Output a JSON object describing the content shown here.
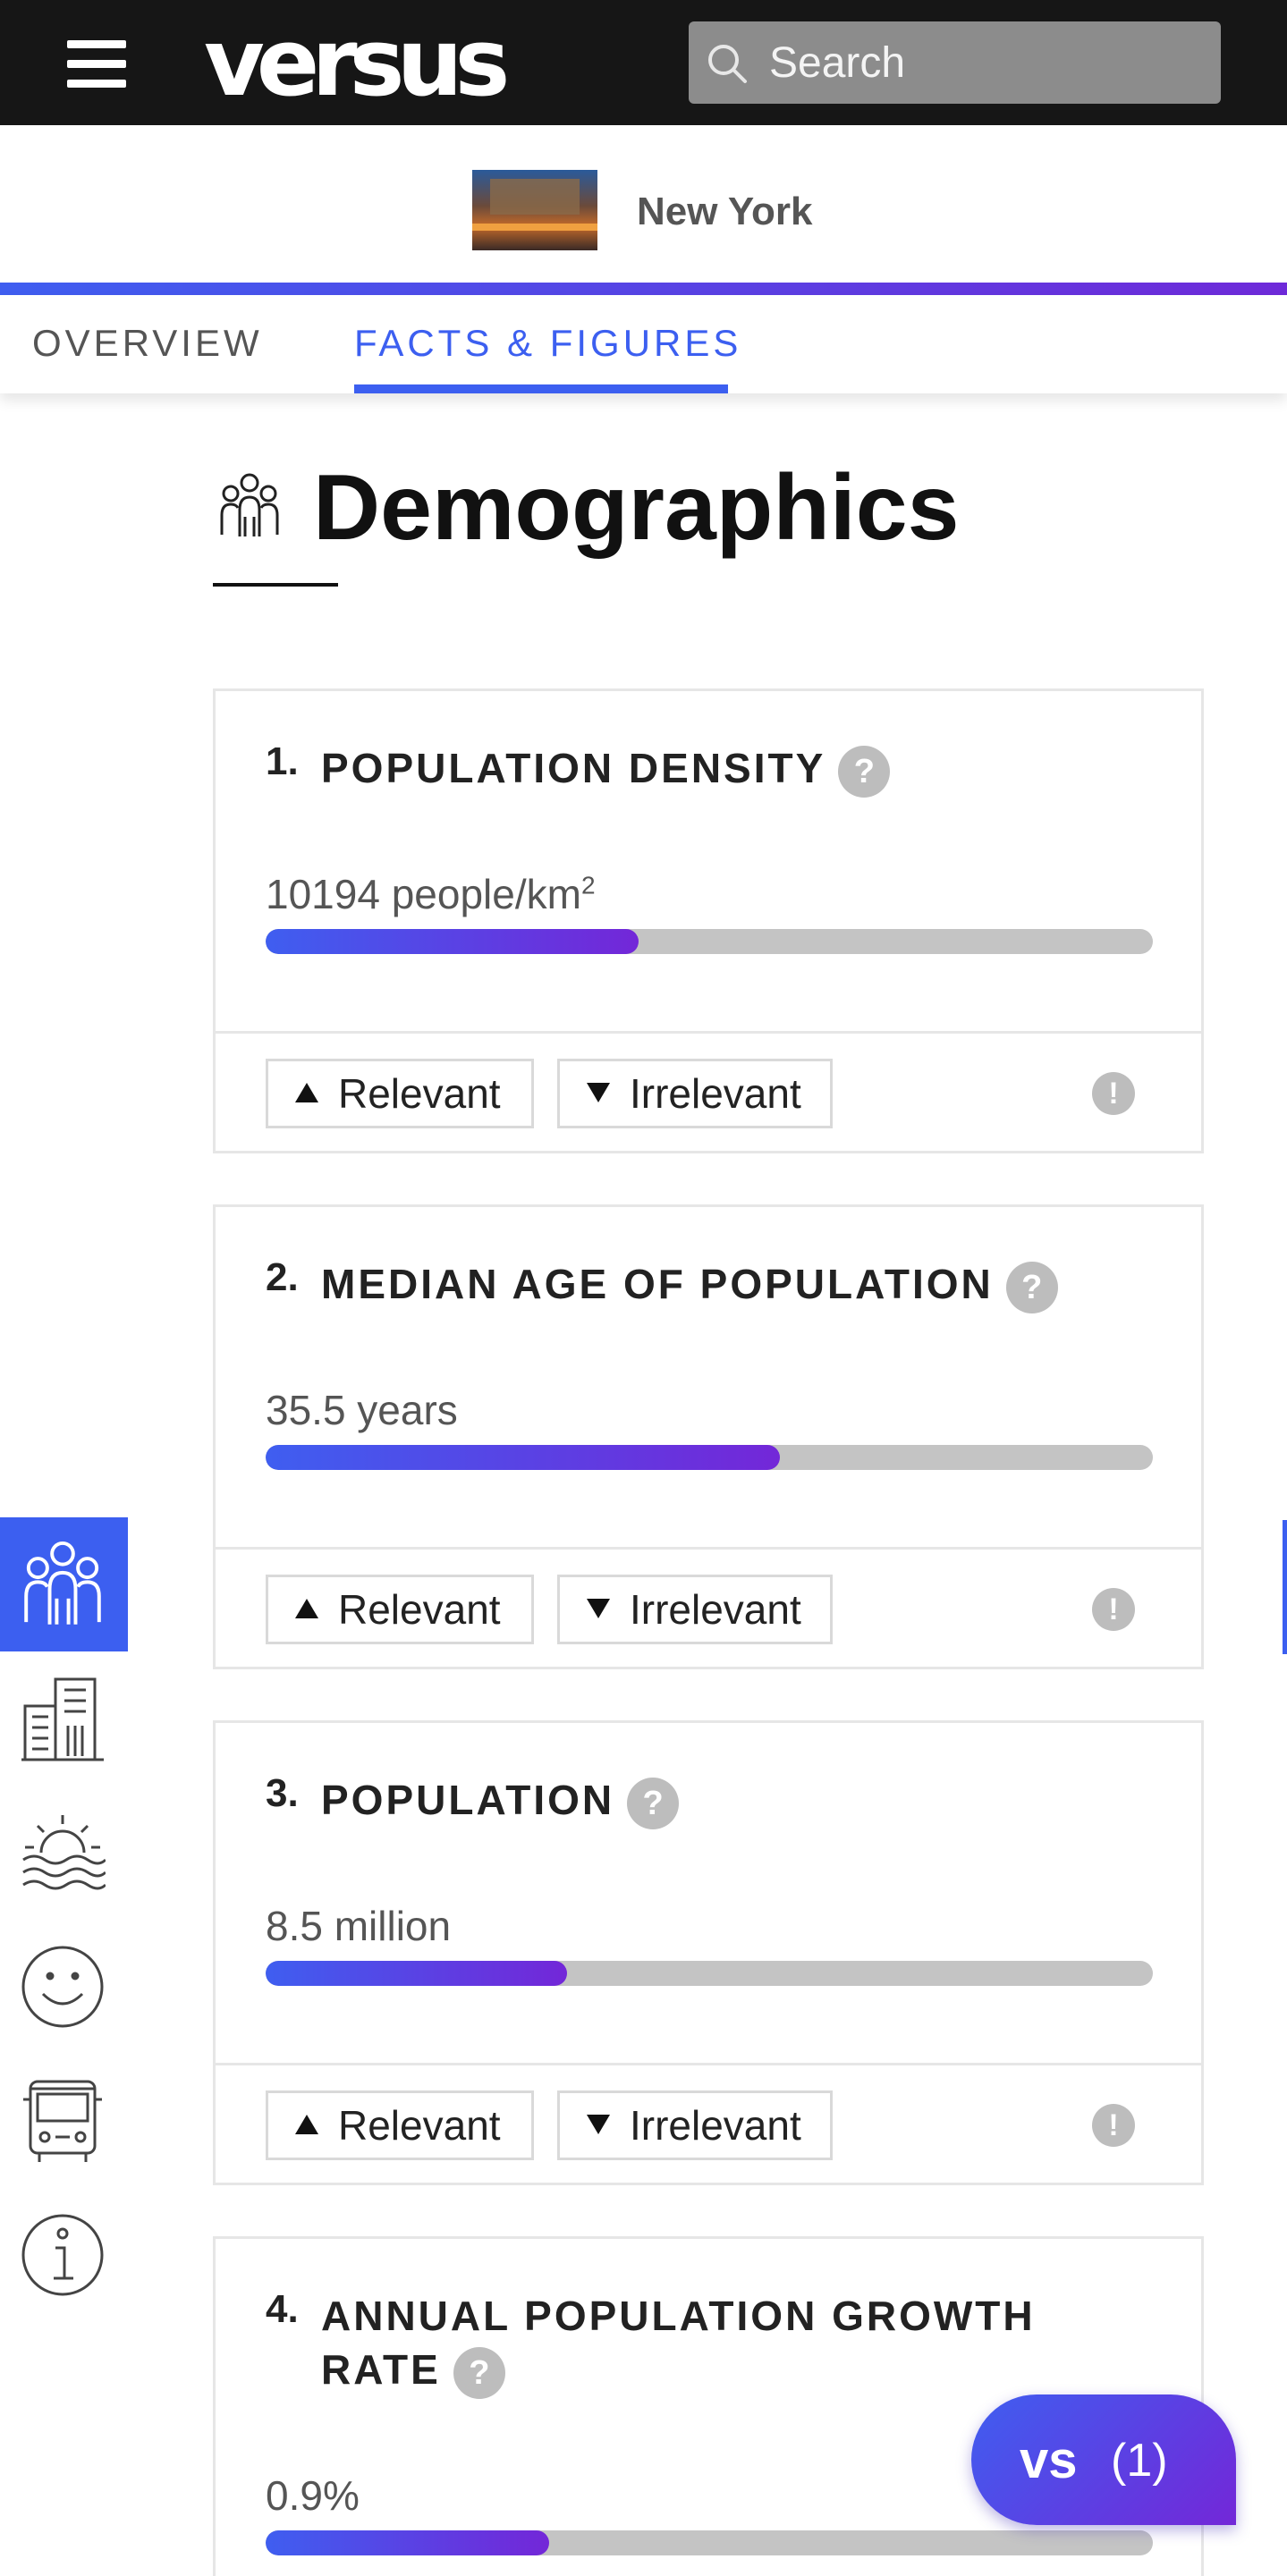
{
  "header": {
    "logo": "versus",
    "search_placeholder": "Search"
  },
  "city": {
    "name": "New York"
  },
  "tabs": [
    {
      "label": "OVERVIEW",
      "active": false
    },
    {
      "label": "FACTS & FIGURES",
      "active": true
    }
  ],
  "section": {
    "title": "Demographics"
  },
  "cards": [
    {
      "number": "1.",
      "title": "POPULATION DENSITY",
      "value": "10194 people/km",
      "value_sup": "2",
      "bar_fraction": 0.42
    },
    {
      "number": "2.",
      "title": "MEDIAN AGE OF POPULATION",
      "value": "35.5 years",
      "bar_fraction": 0.58
    },
    {
      "number": "3.",
      "title": "POPULATION",
      "value": "8.5 million",
      "bar_fraction": 0.34
    },
    {
      "number": "4.",
      "title": "ANNUAL POPULATION GROWTH",
      "title_line2": "RATE",
      "value": "0.9%",
      "bar_fraction": 0.32
    }
  ],
  "vote": {
    "relevant_label": "Relevant",
    "irrelevant_label": "Irrelevant",
    "help_symbol": "?",
    "flag_symbol": "!"
  },
  "sidenav": [
    {
      "icon": "people-icon",
      "active": true
    },
    {
      "icon": "buildings-icon",
      "active": false
    },
    {
      "icon": "sunset-waves-icon",
      "active": false
    },
    {
      "icon": "smiley-icon",
      "active": false
    },
    {
      "icon": "bus-icon",
      "active": false
    },
    {
      "icon": "info-icon",
      "active": false
    }
  ],
  "compare": {
    "label": "vs",
    "count": "(1)"
  },
  "colors": {
    "accent": "#3c5ff0",
    "accent_end": "#7327d8",
    "topbar": "#161616"
  }
}
